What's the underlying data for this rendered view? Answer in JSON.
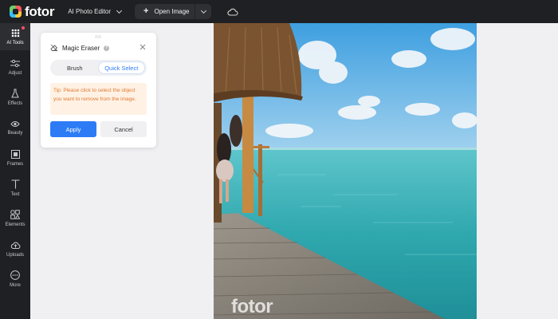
{
  "app": {
    "logo_text": "fotor",
    "editor_menu_label": "AI Photo Editor",
    "open_image_label": "Open Image",
    "brand_color": "#2d7cf6"
  },
  "sidebar": {
    "items": [
      {
        "label": "AI Tools",
        "icon": "grid-icon",
        "active": true
      },
      {
        "label": "Adjust",
        "icon": "sliders-icon"
      },
      {
        "label": "Effects",
        "icon": "flask-icon"
      },
      {
        "label": "Beauty",
        "icon": "eye-icon"
      },
      {
        "label": "Frames",
        "icon": "frame-icon"
      },
      {
        "label": "Text",
        "icon": "text-icon"
      },
      {
        "label": "Elements",
        "icon": "shapes-icon"
      },
      {
        "label": "Uploads",
        "icon": "upload-cloud-icon"
      },
      {
        "label": "More",
        "icon": "more-icon"
      }
    ]
  },
  "panel": {
    "title": "Magic Eraser",
    "help_glyph": "?",
    "mode_brush": "Brush",
    "mode_quick_select": "Quick Select",
    "selected_mode": "Quick Select",
    "tip": "Tip: Please click to select the object you want to remove from the image.",
    "apply_label": "Apply",
    "cancel_label": "Cancel"
  },
  "canvas": {
    "watermark": "fotor"
  }
}
